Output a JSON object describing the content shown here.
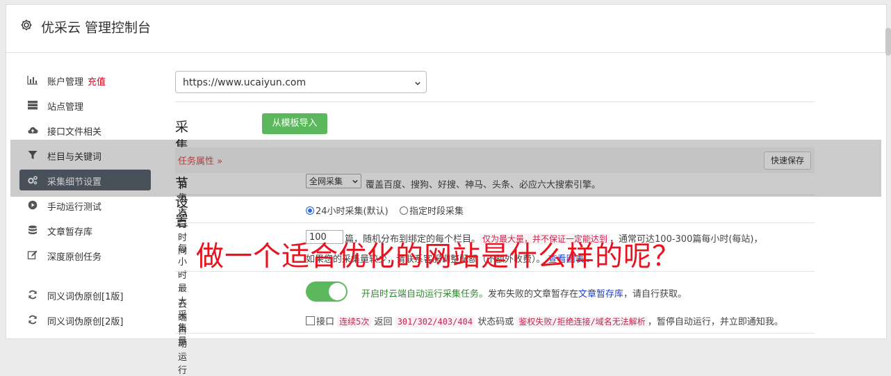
{
  "header": {
    "title": "优采云 管理控制台"
  },
  "sidebar": {
    "items": [
      {
        "label": "账户管理",
        "extra": "充值"
      },
      {
        "label": "站点管理"
      },
      {
        "label": "接口文件相关"
      },
      {
        "label": "栏目与关键词"
      },
      {
        "label": "采集细节设置"
      },
      {
        "label": "手动运行测试"
      },
      {
        "label": "文章暂存库"
      },
      {
        "label": "深度原创任务"
      },
      {
        "label": "同义词伪原创[1版]"
      },
      {
        "label": "同义词伪原创[2版]"
      }
    ]
  },
  "site_select": {
    "value": "https://www.ucaiyun.com"
  },
  "section": {
    "title": "采集细节设置",
    "import_label": "从模板导入"
  },
  "task": {
    "toggle_label": "任务属性 »",
    "save_label": "快速保存"
  },
  "collect_entry": {
    "label": "采集入口",
    "select_value": "全网采集",
    "desc": "覆盖百度、搜狗、好搜、神马、头条、必应六大搜索引擎。"
  },
  "run_time": {
    "label": "运行时间",
    "option1": "24小时采集(默认)",
    "option2": "指定时段采集"
  },
  "per_hour": {
    "label": "每小时最大采集量",
    "value": "100",
    "text1": "篇，随机分布到绑定的每个栏目。",
    "highlight": "仅为最大量，并不保证一定能达到",
    "text2": "，通常可达100-300篇每小时(每站)，",
    "line2": "如果您的采集量较少，请联系客服调整配额（不额外收费）。",
    "link": "查看图表"
  },
  "cloud_run": {
    "label": "云端自动运行",
    "status_text": "开启时云端自动运行采集任务。",
    "desc_pre": "发布失败的文章暂存在",
    "desc_link": "文章暂存库",
    "desc_post": "，请自行获取。",
    "check_pre": "接口",
    "code1": "连续5次",
    "mid1": "返回",
    "code2": "301/302/403/404",
    "mid2": "状态码或",
    "code3": "鉴权失败/拒绝连接/域名无法解析",
    "check_post": "，暂停自动运行，并立即通知我。"
  },
  "watermark": "做一个适合优化的网站是什么样的呢？",
  "colors": {
    "accent_green": "#5cb85c",
    "danger": "#d9001b",
    "watermark": "#e8131f",
    "active_nav": "#5a6470"
  }
}
